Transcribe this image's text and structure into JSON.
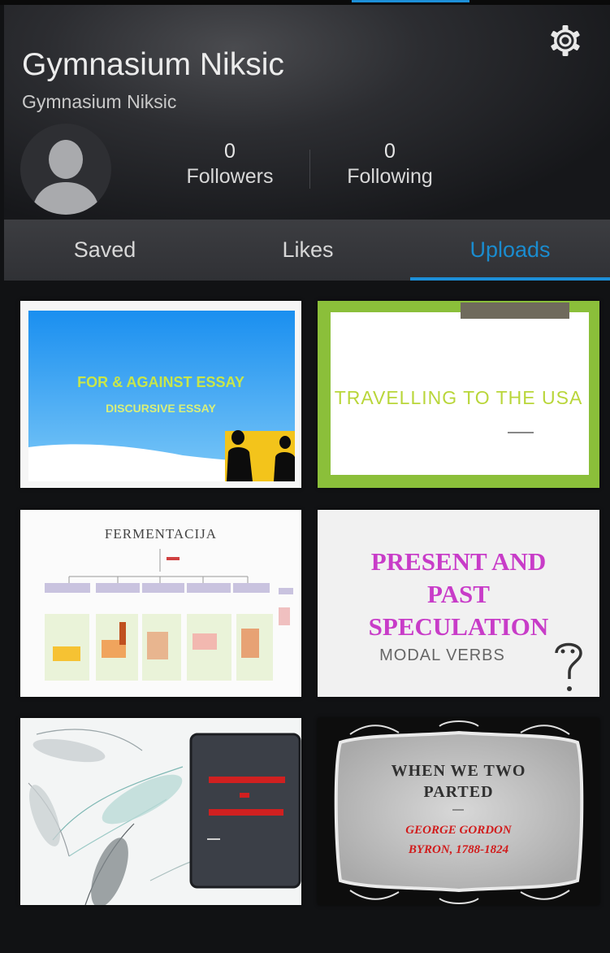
{
  "profile": {
    "name": "Gymnasium Niksic",
    "subtitle": "Gymnasium Niksic",
    "followers_count": "0",
    "followers_label": "Followers",
    "following_count": "0",
    "following_label": "Following"
  },
  "tabs": [
    {
      "label": "Saved",
      "active": false
    },
    {
      "label": "Likes",
      "active": false
    },
    {
      "label": "Uploads",
      "active": true
    }
  ],
  "uploads": [
    {
      "title": "FOR & AGAINST ESSAY",
      "subtitle": "DISCURSIVE ESSAY"
    },
    {
      "title": "TRAVELLING TO THE USA"
    },
    {
      "title": "FERMENTACIJA"
    },
    {
      "title_lines": [
        "PRESENT AND",
        "PAST",
        "SPECULATION"
      ],
      "subtitle": "MODAL VERBS"
    },
    {
      "title": ""
    },
    {
      "title_lines": [
        "WHEN WE TWO",
        "PARTED"
      ],
      "author_lines": [
        "GEORGE GORDON",
        "BYRON, 1788-1824"
      ]
    }
  ],
  "colors": {
    "accent": "#1d8fd8",
    "background": "#111214",
    "header": "#2c2d31",
    "tabbar": "#36373b"
  },
  "icons": {
    "settings": "gear-icon",
    "avatar": "person-silhouette"
  }
}
